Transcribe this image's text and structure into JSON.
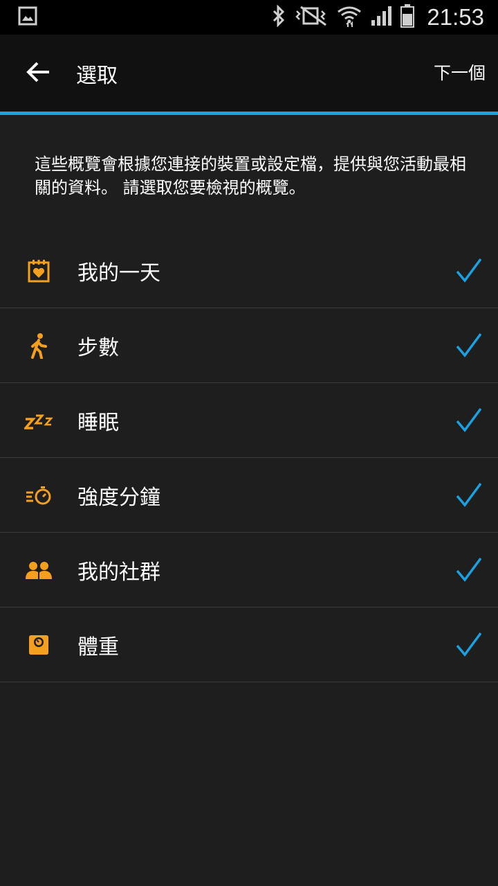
{
  "status_bar": {
    "time": "21:53",
    "icons": [
      "gallery-notification-icon",
      "bluetooth-icon",
      "mute-vibrate-icon",
      "wifi-icon",
      "signal-icon",
      "battery-icon"
    ]
  },
  "app_bar": {
    "title": "選取",
    "next_label": "下一個"
  },
  "intro": "這些概覽會根據您連接的裝置或設定檔，提供與您活動最相關的資料。 請選取您要檢視的概覽。",
  "items": [
    {
      "label": "我的一天",
      "icon": "calendar-heart-icon",
      "checked": true
    },
    {
      "label": "步數",
      "icon": "walking-icon",
      "checked": true
    },
    {
      "label": "睡眠",
      "icon": "sleep-zzz-icon",
      "checked": true
    },
    {
      "label": "強度分鐘",
      "icon": "stopwatch-speed-icon",
      "checked": true
    },
    {
      "label": "我的社群",
      "icon": "people-icon",
      "checked": true
    },
    {
      "label": "體重",
      "icon": "scale-icon",
      "checked": true
    }
  ],
  "colors": {
    "accent": "#1ba1e2",
    "icon_orange": "#f4a01e",
    "background": "#1e1e1e",
    "appbar": "#111111"
  }
}
